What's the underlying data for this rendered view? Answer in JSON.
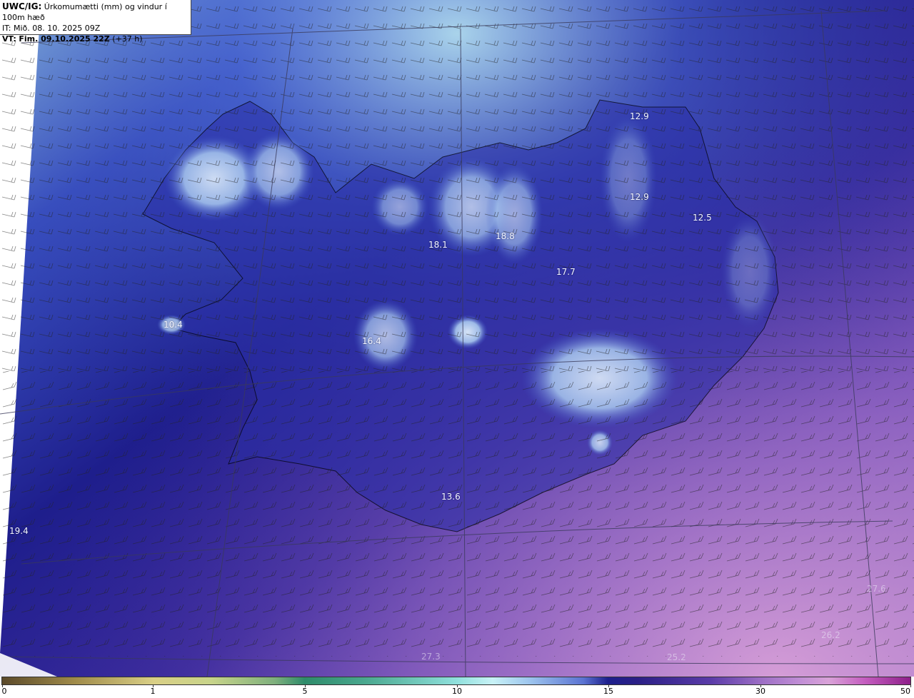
{
  "info_box": {
    "model": "UWC/IG:",
    "title": "Úrkomumætti (mm) og vindur í 100m hæð",
    "init_time": "IT: Mið. 08. 10. 2025 09Z",
    "valid_label": "VT:",
    "valid_time": "Fim. 09.10.2025 22Z",
    "lead": "(+37 h)"
  },
  "values": [
    {
      "text": "12.9",
      "style": "bright"
    },
    {
      "text": "12.9",
      "style": "bright"
    },
    {
      "text": "12.5",
      "style": "bright"
    },
    {
      "text": "18.1",
      "style": "bright"
    },
    {
      "text": "18.8",
      "style": "bright"
    },
    {
      "text": "17.7",
      "style": "bright"
    },
    {
      "text": "10.4",
      "style": "bright"
    },
    {
      "text": "16.4",
      "style": "bright"
    },
    {
      "text": "13.6",
      "style": "bright"
    },
    {
      "text": "19.4",
      "style": "bright"
    },
    {
      "text": "27.3",
      "style": "faint"
    },
    {
      "text": "25.2",
      "style": "faint"
    },
    {
      "text": "26.2",
      "style": "faint"
    },
    {
      "text": "27.6",
      "style": "faint"
    }
  ],
  "colorbar": {
    "ticks": [
      "0",
      "1",
      "5",
      "10",
      "15",
      "30",
      "50"
    ]
  },
  "colors": {
    "low": "#1d1f8c",
    "mid": "#5b73d2",
    "high": "#c28fd6",
    "land_line": "#000000"
  }
}
